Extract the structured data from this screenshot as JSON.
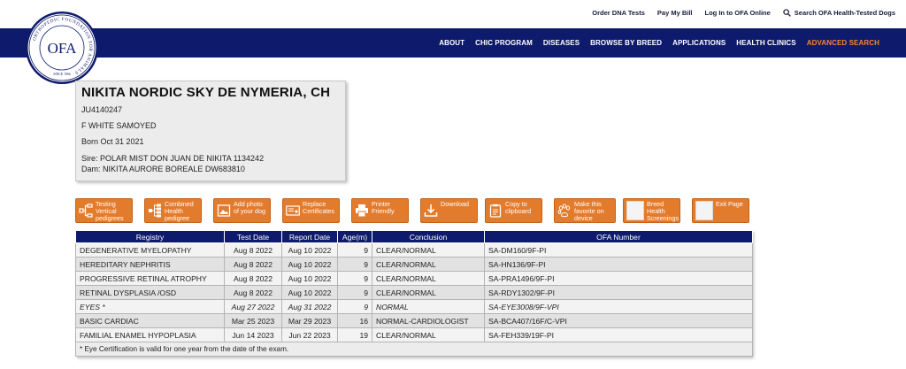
{
  "top_links": [
    {
      "label": "Order DNA Tests"
    },
    {
      "label": "Pay My Bill"
    },
    {
      "label": "Log In to OFA Online"
    }
  ],
  "search_label": "Search OFA Health-Tested Dogs",
  "logo": {
    "text": "OFA",
    "ring_text": "ORTHOPEDIC FOUNDATION FOR ANIMALS",
    "since": "SINCE 1966"
  },
  "nav": [
    {
      "label": "ABOUT"
    },
    {
      "label": "CHIC PROGRAM"
    },
    {
      "label": "DISEASES"
    },
    {
      "label": "BROWSE BY BREED"
    },
    {
      "label": "APPLICATIONS"
    },
    {
      "label": "HEALTH CLINICS"
    },
    {
      "label": "ADVANCED SEARCH",
      "accent": true
    }
  ],
  "dog": {
    "name": "NIKITA NORDIC SKY DE NYMERIA, CH",
    "reg": "JU4140247",
    "sex_breed": "F WHITE SAMOYED",
    "born": "Born Oct 31 2021",
    "sire": "Sire: POLAR MIST DON JUAN DE NIKITA 1134242",
    "dam": "Dam: NIKITA AURORE BOREALE DW683810"
  },
  "buttons": [
    {
      "l1": "Testing",
      "l2": "Vertical",
      "l3": "pedigrees",
      "icon": "vertical-pedigree-icon"
    },
    {
      "l1": "Combined",
      "l2": "Health",
      "l3": "pedigree",
      "icon": "combined-pedigree-icon"
    },
    {
      "l1": "Add photo",
      "l2": "of your dog",
      "l3": "",
      "icon": "photo-icon"
    },
    {
      "l1": "Replace",
      "l2": "Certificates",
      "l3": "",
      "icon": "certificate-icon"
    },
    {
      "l1": "Printer",
      "l2": "Friendly",
      "l3": "",
      "icon": "printer-icon"
    },
    {
      "l1": "Download",
      "l2": "",
      "l3": "",
      "icon": "download-icon"
    },
    {
      "l1": "Copy to",
      "l2": "clipboard",
      "l3": "",
      "icon": "clipboard-icon"
    },
    {
      "l1": "Make this",
      "l2": "favorite on",
      "l3": "device",
      "icon": "paw-icon"
    },
    {
      "l1": "Breed",
      "l2": "Health",
      "l3": "Screenings",
      "icon": "broken-image-icon"
    },
    {
      "l1": "Exit Page",
      "l2": "",
      "l3": "",
      "icon": "broken-image-icon"
    }
  ],
  "table": {
    "headers": [
      "Registry",
      "Test Date",
      "Report Date",
      "Age(m)",
      "Conclusion",
      "OFA Number"
    ],
    "rows": [
      {
        "registry": "DEGENERATIVE MYELOPATHY",
        "test": "Aug 8 2022",
        "report": "Aug 10 2022",
        "age": "9",
        "conclusion": "CLEAR/NORMAL",
        "ofa": "SA-DM160/9F-PI",
        "italic": false
      },
      {
        "registry": "HEREDITARY NEPHRITIS",
        "test": "Aug 8 2022",
        "report": "Aug 10 2022",
        "age": "9",
        "conclusion": "CLEAR/NORMAL",
        "ofa": "SA-HN136/9F-PI",
        "italic": false
      },
      {
        "registry": "PROGRESSIVE RETINAL ATROPHY",
        "test": "Aug 8 2022",
        "report": "Aug 10 2022",
        "age": "9",
        "conclusion": "CLEAR/NORMAL",
        "ofa": "SA-PRA1496/9F-PI",
        "italic": false
      },
      {
        "registry": "RETINAL DYSPLASIA /OSD",
        "test": "Aug 8 2022",
        "report": "Aug 10 2022",
        "age": "9",
        "conclusion": "CLEAR/NORMAL",
        "ofa": "SA-RDY1302/9F-PI",
        "italic": false
      },
      {
        "registry": "EYES *",
        "test": "Aug 27 2022",
        "report": "Aug 31 2022",
        "age": "9",
        "conclusion": "NORMAL",
        "ofa": "SA-EYE3008/9F-VPI",
        "italic": true
      },
      {
        "registry": "BASIC CARDIAC",
        "test": "Mar 25 2023",
        "report": "Mar 29 2023",
        "age": "16",
        "conclusion": "NORMAL-CARDIOLOGIST",
        "ofa": "SA-BCA407/16F/C-VPI",
        "italic": false
      },
      {
        "registry": "FAMILIAL ENAMEL HYPOPLASIA",
        "test": "Jun 14 2023",
        "report": "Jun 22 2023",
        "age": "19",
        "conclusion": "CLEAR/NORMAL",
        "ofa": "SA-FEH339/19F-PI",
        "italic": false
      }
    ],
    "footnote": "* Eye Certification is valid for one year from the date of the exam."
  },
  "colors": {
    "navy": "#0e1a6b",
    "orange": "#e37b2d",
    "accent": "#f08a2b"
  }
}
